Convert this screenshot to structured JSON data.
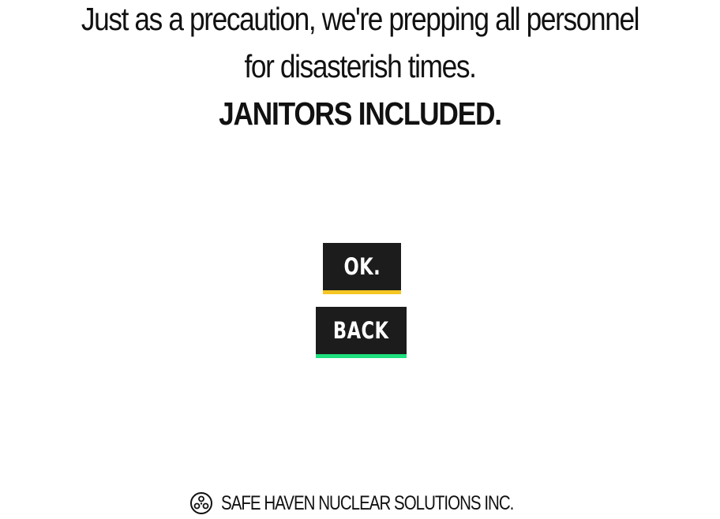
{
  "message": {
    "line1": "Just as a precaution, we're prepping all personnel",
    "line2": "for disasterish times.",
    "line3": "JANITORS INCLUDED."
  },
  "buttons": {
    "ok_label": "OK.",
    "back_label": "BACK"
  },
  "colors": {
    "ok_accent": "#f5c623",
    "back_accent": "#1ee07f",
    "button_bg": "#1c1c1c"
  },
  "footer": {
    "logo_icon": "radiation-logo-icon",
    "company_name": "SAFE HAVEN NUCLEAR SOLUTIONS INC."
  }
}
